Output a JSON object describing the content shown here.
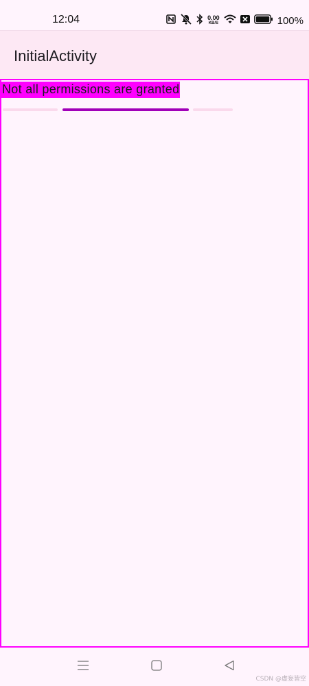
{
  "status_bar": {
    "time": "12:04",
    "net_speed_value": "0.00",
    "net_speed_unit": "KB/S",
    "battery_percent": "100%",
    "icons": [
      "nfc-icon",
      "mute-icon",
      "bluetooth-icon",
      "wifi-icon",
      "sim-icon",
      "battery-icon"
    ]
  },
  "app_bar": {
    "title": "InitialActivity"
  },
  "content": {
    "message": "Not all permissions are granted",
    "progress": {
      "indeterminate": true,
      "value_fraction": 0.55
    }
  },
  "nav_bar": {
    "buttons": [
      "menu-icon",
      "home-icon",
      "back-icon"
    ]
  },
  "watermark": "CSDN @虚妄皆空",
  "colors": {
    "background": "#fff4fd",
    "app_bar": "#fde8f4",
    "highlight": "#ff00ff",
    "progress_active": "#a100b8",
    "progress_track": "#fad9ec"
  }
}
